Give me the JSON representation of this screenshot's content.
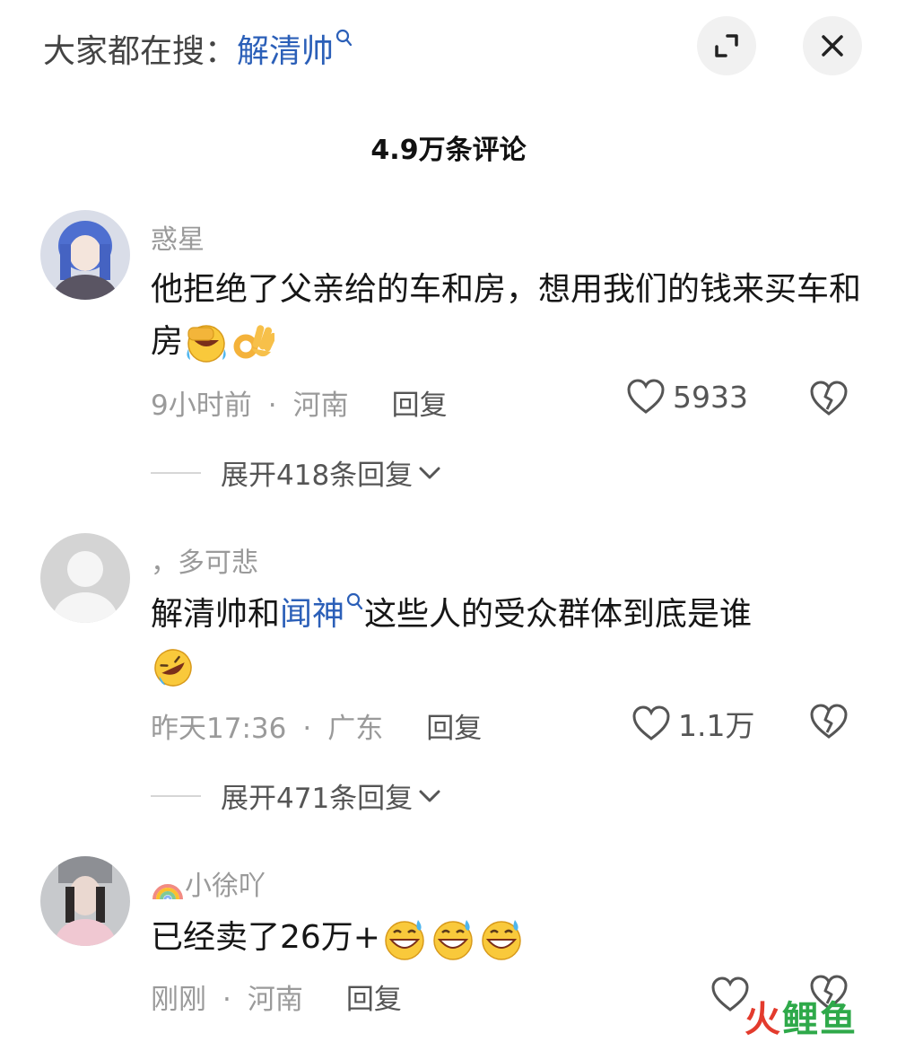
{
  "header": {
    "search_prefix": "大家都在搜：",
    "search_term": "解清帅",
    "icons": {
      "search": "search-icon",
      "expand": "expand-icon",
      "close": "close-icon"
    }
  },
  "comment_count": "4.9万条评论",
  "comments": [
    {
      "username": "惑星",
      "text": "他拒绝了父亲给的车和房，想用我们的钱来买车和房",
      "emojis": [
        "facepalm-laughing-emoji",
        "ok-hand-emoji"
      ],
      "time": "9小时前",
      "location": "河南",
      "reply_label": "回复",
      "likes": "5933",
      "expand_label": "展开418条回复"
    },
    {
      "username": "，多可悲",
      "text_before": "解清帅和",
      "text_link": "闻神",
      "text_after": "这些人的受众群体到底是谁",
      "emojis": [
        "rolling-laughing-emoji"
      ],
      "time": "昨天17:36",
      "location": "广东",
      "reply_label": "回复",
      "likes": "1.1万",
      "expand_label": "展开471条回复"
    },
    {
      "username": "小徐吖",
      "username_prefix_icon": "rainbow-icon",
      "text": "已经卖了26万+",
      "emojis": [
        "grinning-sweat-emoji",
        "grinning-sweat-emoji",
        "grinning-sweat-emoji"
      ],
      "time": "刚刚",
      "location": "河南",
      "reply_label": "回复"
    }
  ],
  "watermark": {
    "part1": "火",
    "part2": "鲤鱼"
  },
  "colors": {
    "link": "#2b5fb8",
    "meta": "#9a9a9a",
    "watermark_red": "#e33b2d",
    "watermark_green": "#2fa94a"
  }
}
